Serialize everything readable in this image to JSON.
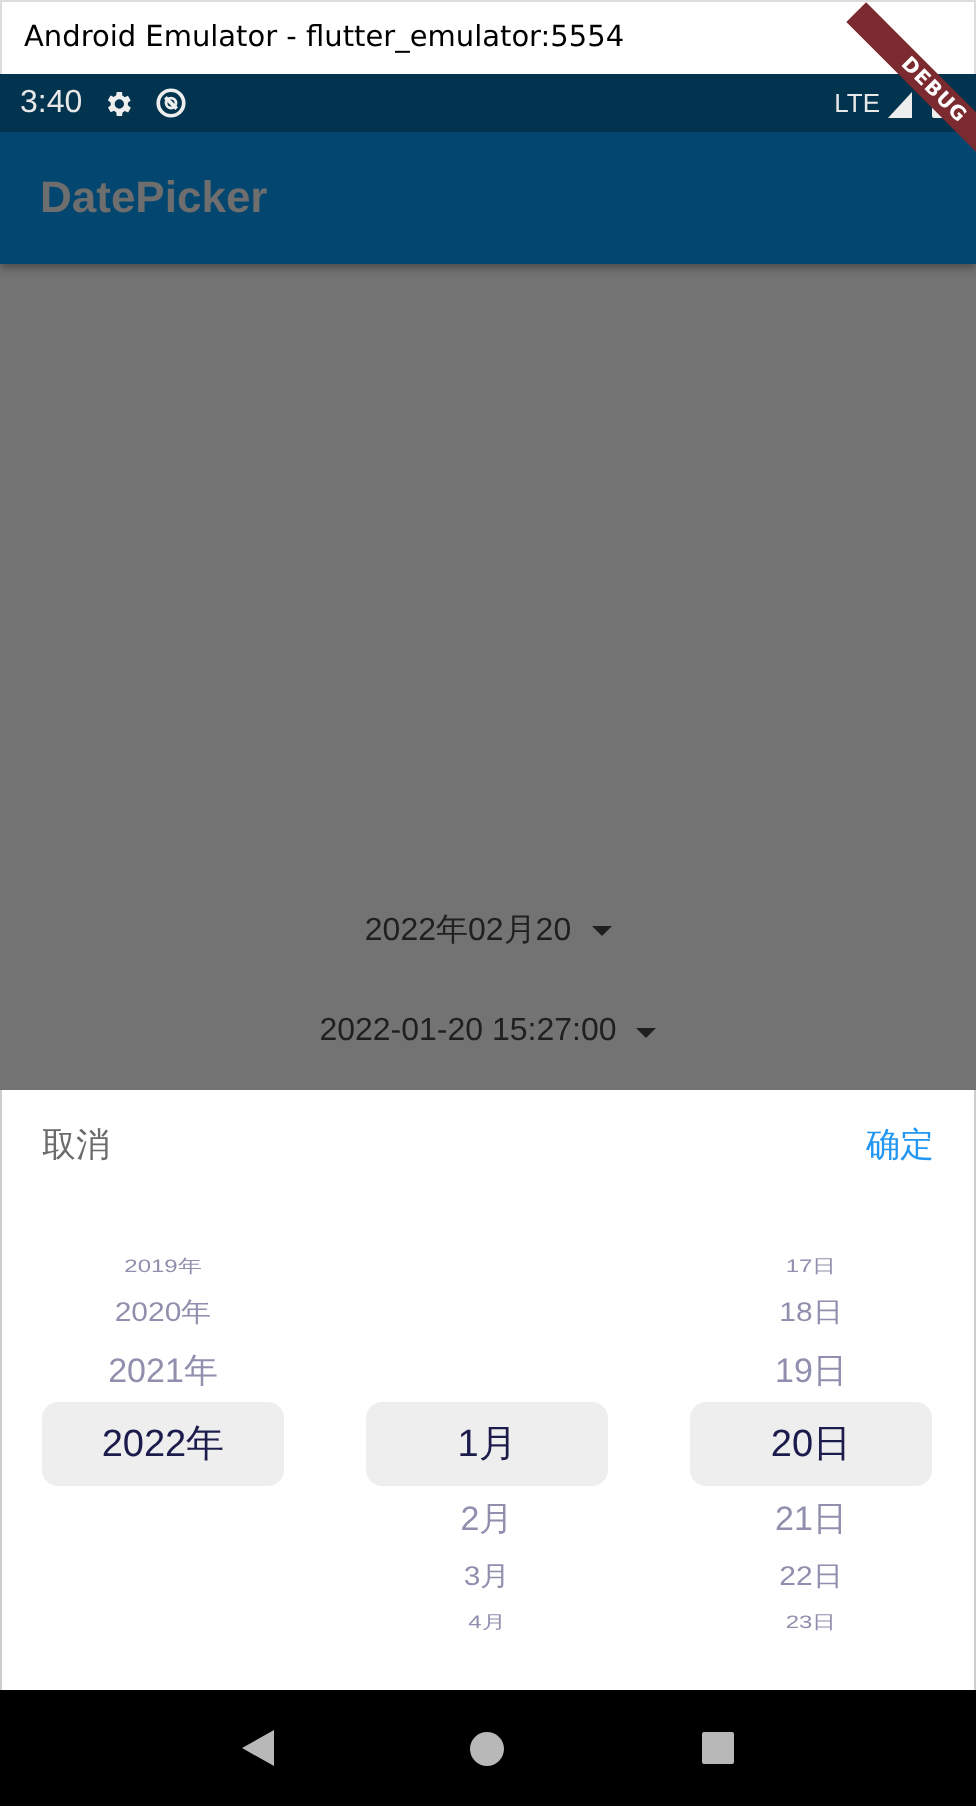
{
  "window": {
    "title": "Android Emulator - flutter_emulator:5554"
  },
  "status_bar": {
    "time": "3:40",
    "network": "LTE"
  },
  "debug_banner": {
    "label": "DEBUG"
  },
  "app_bar": {
    "title": "DatePicker"
  },
  "dropdowns": [
    {
      "value": "2022年02月20"
    },
    {
      "value": "2022-01-20 15:27:00"
    }
  ],
  "picker": {
    "cancel": "取消",
    "confirm": "确定",
    "columns": [
      {
        "items": [
          {
            "label": "2019年",
            "selected": false
          },
          {
            "label": "2020年",
            "selected": false
          },
          {
            "label": "2021年",
            "selected": false
          },
          {
            "label": "2022年",
            "selected": true
          }
        ]
      },
      {
        "items": [
          {
            "label": "1月",
            "selected": true
          },
          {
            "label": "2月",
            "selected": false
          },
          {
            "label": "3月",
            "selected": false
          },
          {
            "label": "4月",
            "selected": false
          }
        ]
      },
      {
        "items": [
          {
            "label": "17日",
            "selected": false
          },
          {
            "label": "18日",
            "selected": false
          },
          {
            "label": "19日",
            "selected": false
          },
          {
            "label": "20日",
            "selected": true
          },
          {
            "label": "21日",
            "selected": false
          },
          {
            "label": "22日",
            "selected": false
          },
          {
            "label": "23日",
            "selected": false
          }
        ]
      }
    ]
  }
}
